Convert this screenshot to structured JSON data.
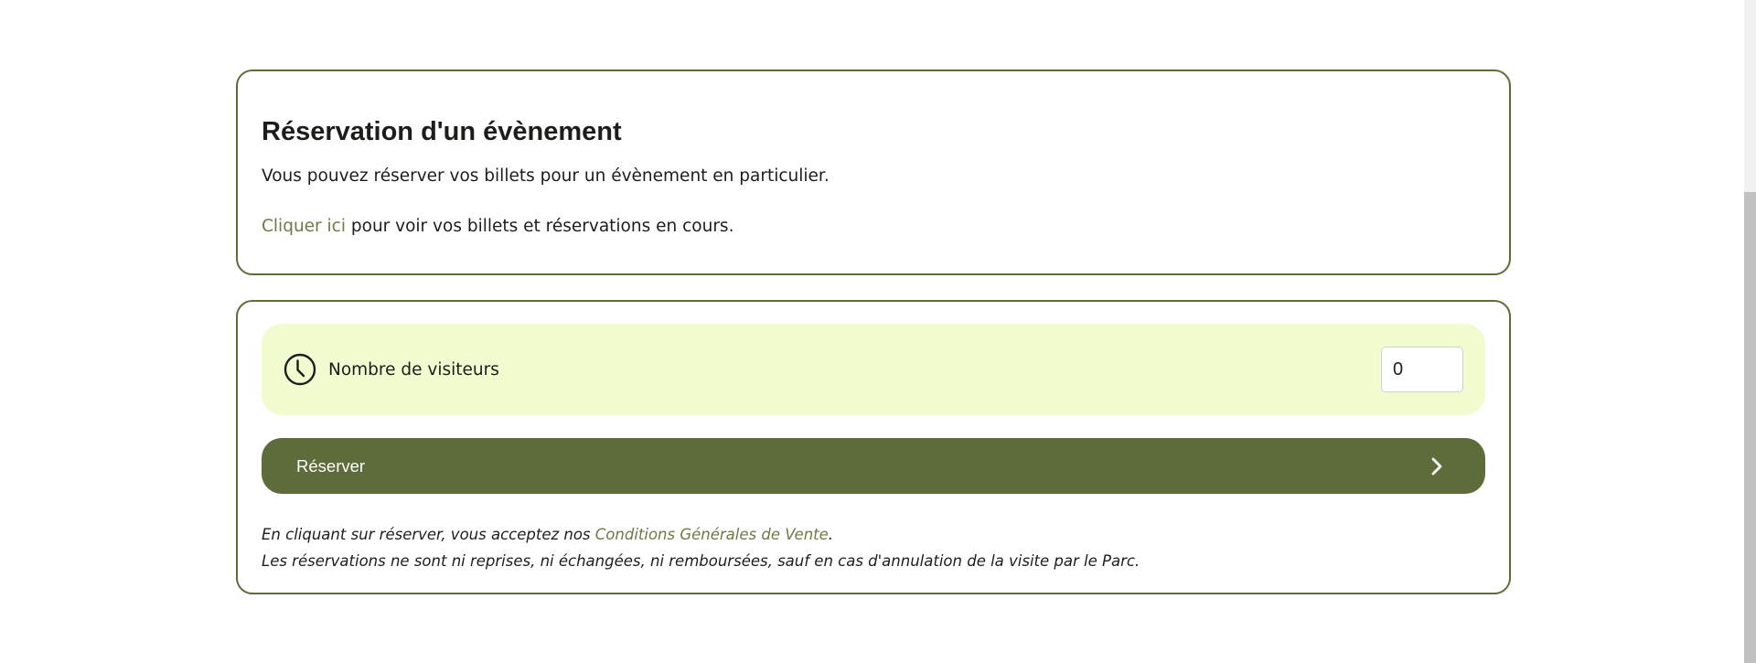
{
  "info": {
    "title": "Réservation d'un évènement",
    "intro": "Vous pouvez réserver vos billets pour un évènement en particulier.",
    "link_label": "Cliquer ici",
    "link_suffix": " pour voir vos billets et réservations en cours."
  },
  "booking": {
    "visitors_icon": "clock-icon",
    "visitors_label": "Nombre de visiteurs",
    "visitors_value": "0",
    "reserve_label": "Réserver",
    "reserve_icon": "chevron-right-icon",
    "legal_prefix": "En cliquant sur réserver, vous acceptez nos ",
    "legal_link": "Conditions Générales de Vente",
    "legal_suffix": ".",
    "legal_note": "Les réservations ne sont ni reprises, ni échangées, ni remboursées, sauf en cas d'annulation de la visite par le Parc."
  },
  "colors": {
    "accent": "#5e6b3a",
    "highlight_bg": "#f1fbd0",
    "link": "#6d7a45"
  }
}
